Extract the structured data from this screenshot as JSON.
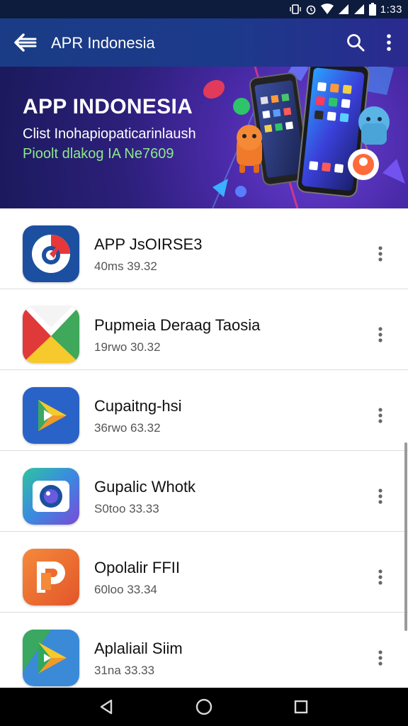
{
  "status_bar": {
    "time": "1:33"
  },
  "app_bar": {
    "title": "APR Indonesia"
  },
  "banner": {
    "title": "APP INDONESIA",
    "line1": "Clist Inohapiopaticarinlaush",
    "line2": "Pioolt dlakog IA Ne7609"
  },
  "apps": [
    {
      "name": "APP JsOIRSE3",
      "meta": "40ms 39.32",
      "icon": "chrome-like-icon"
    },
    {
      "name": "Pupmeia Deraag Taosia",
      "meta": "19rwo 30.32",
      "icon": "gmail-like-icon"
    },
    {
      "name": "Cupaitng-hsi",
      "meta": "36rwo 63.32",
      "icon": "play-triangle-icon"
    },
    {
      "name": "Gupalic Whotk",
      "meta": "S0too 33.33",
      "icon": "camera-lens-icon"
    },
    {
      "name": "Opolalir FFII",
      "meta": "60loo 33.34",
      "icon": "letter-p-icon"
    },
    {
      "name": "Aplaliail Siim",
      "meta": "31na 33.33",
      "icon": "play-triangle-green-icon"
    }
  ],
  "colors": {
    "app_bar": "#1c3a8a",
    "status_bar": "#0d1b3d",
    "banner_accent": "#8de88a"
  }
}
